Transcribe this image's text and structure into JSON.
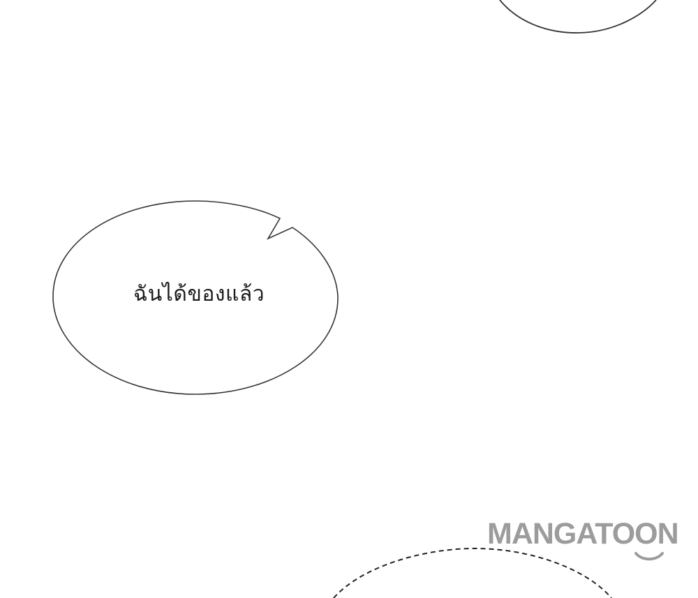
{
  "bubble": {
    "text": "ฉันได้ของแล้ว"
  },
  "watermark": {
    "brand": "MANGATOON",
    "color": "#9c9c9c"
  },
  "colors": {
    "background": "#ffffff",
    "outline": "#333333"
  }
}
